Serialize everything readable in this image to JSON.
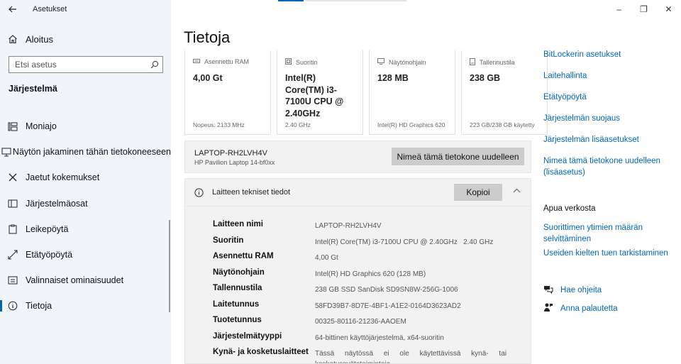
{
  "window": {
    "title": "Asetukset",
    "controls": [
      "–",
      "❐",
      "✕"
    ]
  },
  "sidebar": {
    "home_label": "Aloitus",
    "search_placeholder": "Etsi asetus",
    "section_title": "Järjestelmä",
    "items": [
      {
        "label": "Moniajo",
        "icon": "multitask-icon"
      },
      {
        "label": "Näytön jakaminen tähän tietokoneeseen",
        "icon": "project-icon"
      },
      {
        "label": "Jaetut kokemukset",
        "icon": "shared-icon"
      },
      {
        "label": "Järjestelmäosat",
        "icon": "components-icon"
      },
      {
        "label": "Leikepöytä",
        "icon": "clipboard-icon"
      },
      {
        "label": "Etätyöpöytä",
        "icon": "remote-icon"
      },
      {
        "label": "Valinnaiset ominaisuudet",
        "icon": "optional-icon"
      },
      {
        "label": "Tietoja",
        "icon": "info-icon",
        "active": true
      }
    ]
  },
  "main": {
    "title": "Tietoja",
    "cards": [
      {
        "label": "Asennettu RAM",
        "value": "4,00 Gt",
        "sub": "Nopeus: 2133 MHz",
        "icon": "ram-icon"
      },
      {
        "label": "Suoritin",
        "value": "Intel(R) Core(TM) i3-7100U CPU @ 2.40GHz",
        "sub": "2.40 GHz",
        "icon": "cpu-icon"
      },
      {
        "label": "Näytönohjain",
        "value": "128 MB",
        "sub": "Intel(R) HD Graphics 620",
        "icon": "gpu-icon"
      },
      {
        "label": "Tallennustila",
        "value": "238 GB",
        "sub": "223 GB/238 GB käytetty",
        "icon": "storage-icon"
      }
    ],
    "device_name": "LAPTOP-RH2LVH4V",
    "device_model": "HP Pavilion Laptop 14-bf0xx",
    "rename_button": "Nimeä tämä tietokone uudelleen",
    "specs_title": "Laitteen tekniset tiedot",
    "copy_button": "Kopioi",
    "specs": [
      {
        "key": "Laitteen nimi",
        "value": "LAPTOP-RH2LVH4V"
      },
      {
        "key": "Suoritin",
        "value": "Intel(R) Core(TM) i3-7100U CPU @ 2.40GHz   2.40 GHz"
      },
      {
        "key": "Asennettu RAM",
        "value": "4,00 Gt"
      },
      {
        "key": "Näytönohjain",
        "value": "Intel(R) HD Graphics 620 (128 MB)"
      },
      {
        "key": "Tallennustila",
        "value": "238 GB SSD SanDisk SD9SN8W-256G-1006"
      },
      {
        "key": "Laitetunnus",
        "value": "58FD39B7-8D7E-4BF1-A1E2-0164D3623AD2"
      },
      {
        "key": "Tuotetunnus",
        "value": "00325-80116-21236-AAOEM"
      },
      {
        "key": "Järjestelmätyyppi",
        "value": "64-bittinen käyttöjärjestelmä, x64-suoritin"
      },
      {
        "key": "Kynä- ja kosketuslaitteet",
        "value": "Tässä näytössä ei ole käytettävissä kynä- tai kosketussyötetoimintoja."
      }
    ]
  },
  "related": {
    "links": [
      "BitLockerin asetukset",
      "Laitehallinta",
      "Etätyöpöytä",
      "Järjestelmän suojaus",
      "Järjestelmän lisäasetukset",
      "Nimeä tämä tietokone uudelleen (lisäasetus)"
    ],
    "help_title": "Apua verkosta",
    "help_links": [
      "Suorittimen ytimien määrän selvittäminen",
      "Useiden kielten tuen tarkistaminen"
    ],
    "get_help": "Hae ohjeita",
    "feedback": "Anna palautetta"
  }
}
